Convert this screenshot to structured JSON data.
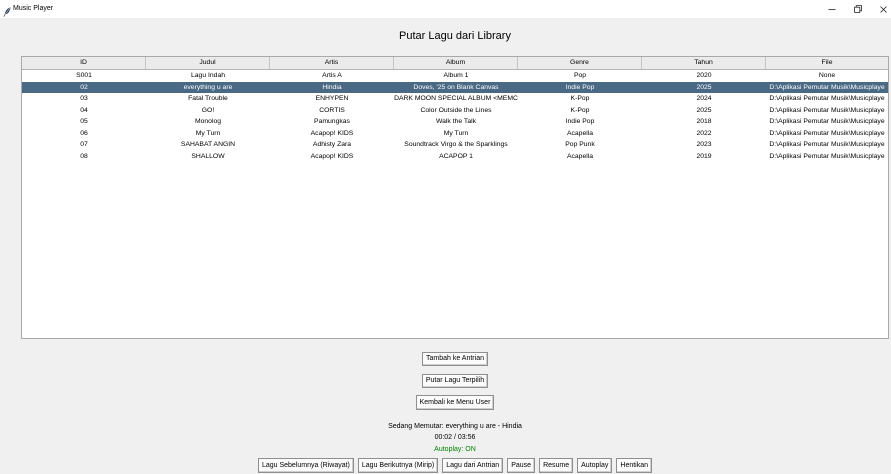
{
  "window": {
    "title": "Music Player",
    "icons": {
      "app": "feather-icon",
      "minimize": "minimize-icon",
      "restore": "restore-icon",
      "close": "close-icon"
    }
  },
  "heading": "Putar Lagu dari Library",
  "library_table": {
    "columns": [
      "ID",
      "Judul",
      "Artis",
      "Album",
      "Genre",
      "Tahun",
      "File"
    ],
    "selected_row": 1,
    "rows": [
      [
        "S001",
        "Lagu Indah",
        "Artis A",
        "Album 1",
        "Pop",
        "2020",
        "None"
      ],
      [
        "02",
        "everything u are",
        "Hindia",
        "Doves, '25 on Blank Canvas",
        "Indie Pop",
        "2025",
        "D:\\Aplikasi Pemutar Musik\\Musicplaye"
      ],
      [
        "03",
        "Fatal Trouble",
        "ENHYPEN",
        "DARK MOON SPECIAL ALBUM <MEMC",
        "K-Pop",
        "2024",
        "D:\\Aplikasi Pemutar Musik\\Musicplaye"
      ],
      [
        "04",
        "GO!",
        "CORTIS",
        "Color Outside the Lines",
        "K-Pop",
        "2025",
        "D:\\Aplikasi Pemutar Musik\\Musicplaye"
      ],
      [
        "05",
        "Monolog",
        "Pamungkas",
        "Walk the Talk",
        "Indie Pop",
        "2018",
        "D:\\Aplikasi Pemutar Musik\\Musicplaye"
      ],
      [
        "06",
        "My Turn",
        "Acapop! KIDS",
        "My Turn",
        "Acapella",
        "2022",
        "D:\\Aplikasi Pemutar Musik\\Musicplaye"
      ],
      [
        "07",
        "SAHABAT ANGIN",
        "Adhisty Zara",
        "Soundtrack Virgo & the Sparklings",
        "Pop Punk",
        "2023",
        "D:\\Aplikasi Pemutar Musik\\Musicplaye"
      ],
      [
        "08",
        "SHALLOW",
        "Acapop! KIDS",
        "ACAPOP 1",
        "Acapella",
        "2019",
        "D:\\Aplikasi Pemutar Musik\\Musicplaye"
      ]
    ]
  },
  "actions": {
    "add_to_queue": "Tambah ke Antrian",
    "play_selected": "Putar Lagu Terpilih",
    "back_to_menu": "Kembali ke Menu User"
  },
  "now_playing": {
    "status": "Sedang Memutar: everything u are - Hindia",
    "time": "00:02 / 03:56",
    "autoplay": "Autoplay: ON"
  },
  "playback_controls": {
    "previous_history": "Lagu Sebelumnya (Riwayat)",
    "next_similar": "Lagu Berikutnya (Mirip)",
    "from_queue": "Lagu dari Antrian",
    "pause": "Pause",
    "resume": "Resume",
    "autoplay": "Autoplay",
    "stop": "Hentikan"
  },
  "colors": {
    "background": "#f0f0f0",
    "selection": "#4a6984",
    "selection_text": "#ffffff",
    "autoplay_on": "#008000"
  }
}
